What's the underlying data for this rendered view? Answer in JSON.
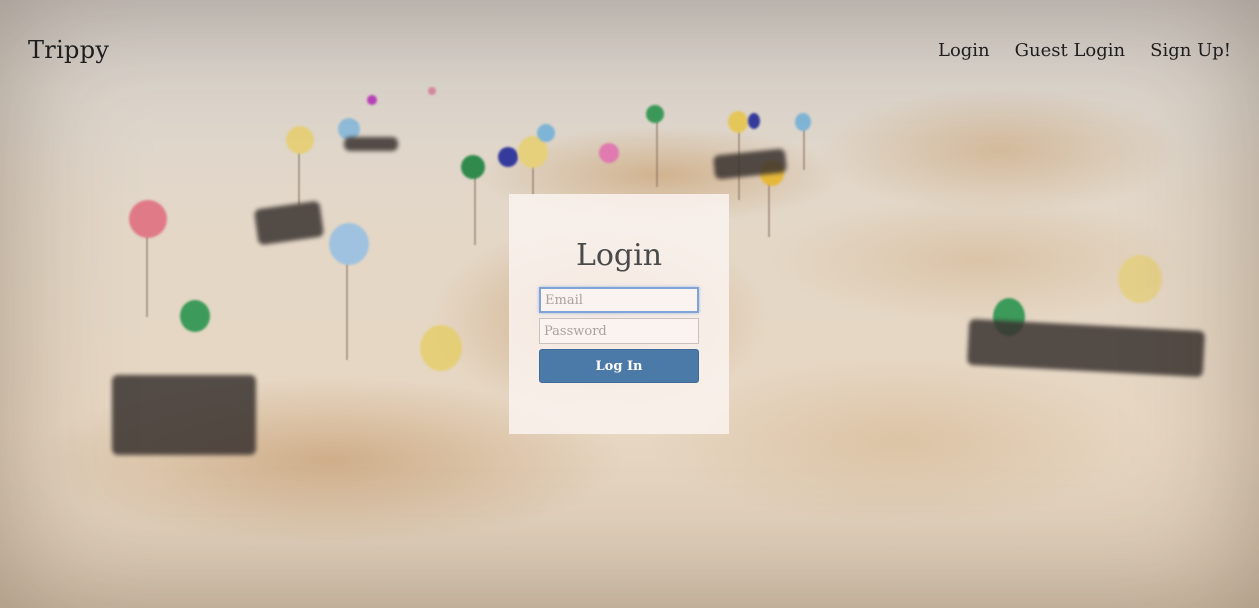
{
  "header": {
    "brand": "Trippy",
    "nav": [
      {
        "label": "Login"
      },
      {
        "label": "Guest Login"
      },
      {
        "label": "Sign Up!"
      }
    ]
  },
  "login_form": {
    "title": "Login",
    "email_placeholder": "Email",
    "email_value": "",
    "password_placeholder": "Password",
    "password_value": "",
    "submit_label": "Log In"
  },
  "colors": {
    "button": "#4b7aa8",
    "card": "#faf3f0",
    "text": "#1d1d1d"
  }
}
